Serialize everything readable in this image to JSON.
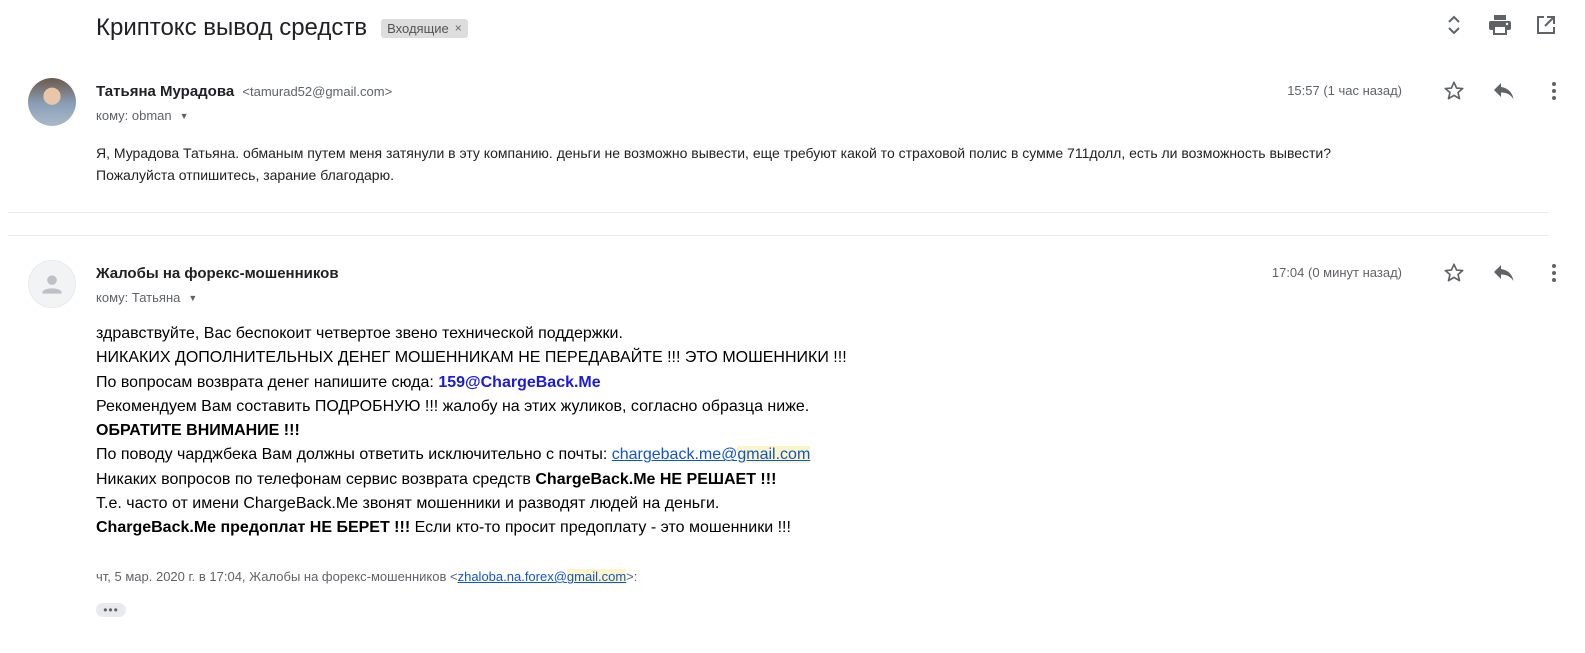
{
  "thread": {
    "subject": "Криптокс вывод средств",
    "label": "Входящие",
    "label_remove": "×"
  },
  "toolbar": {
    "icons": [
      "expand-collapse-icon",
      "print-icon",
      "open-new-window-icon"
    ]
  },
  "message1": {
    "sender_name": "Татьяна Мурадова",
    "sender_email": "<tamurad52@gmail.com>",
    "to_label": "кому: obman",
    "time": "15:57 (1 час назад)",
    "body_line1": "Я, Мурадова Татьяна. обманым путем меня затянули в эту компанию. деньги не возможно вывести,  еще  требуют какой то страховой полис в сумме 711долл,  есть ли возможность вывести?",
    "body_line2": "Пожалуйста отпишитесь, зарание благодарю."
  },
  "message2": {
    "sender_name": "Жалобы на форекс-мошенников",
    "to_label": "кому: Татьяна",
    "time": "17:04 (0 минут назад)",
    "line1": "здравствуйте, Вас беспокоит четвертое звено технической поддержки.",
    "line2": "НИКАКИХ ДОПОЛНИТЕЛЬНЫХ ДЕНЕГ МОШЕННИКАМ НЕ ПЕРЕДАВАЙТЕ !!! ЭТО МОШЕННИКИ !!!",
    "line3_prefix": "По вопросам возврата денег напишите сюда: ",
    "line3_email": "159@ChargeBack.Me",
    "line4": "Рекомендуем Вам составить ПОДРОБНУЮ !!! жалобу на этих жуликов, согласно образца ниже.",
    "line5": "ОБРАТИТЕ ВНИМАНИЕ !!!",
    "line6_prefix": "По поводу чарджбека Вам должны ответить исключительно с почты: ",
    "line6_link_a": "chargeback.me@",
    "line6_link_b": "gmail.com",
    "line7_prefix": "Никаких вопросов по телефонам сервис возврата средств ",
    "line7_bold": "ChargeBack.Me НЕ РЕШАЕТ !!!",
    "line8": "Т.е. часто от имени ChargeBack.Me звонят мошенники и разводят людей на деньги.",
    "line9_bold": "ChargeBack.Me предоплат НЕ БЕРЕТ !!!",
    "line9_rest": " Если кто-то просит предоплату - это мошенники !!!",
    "quote_prefix": "чт, 5 мар. 2020 г. в 17:04, Жалобы на форекс-мошенников <",
    "quote_link_a": "zhaloba.na.forex@",
    "quote_link_b": "gmail.com",
    "quote_suffix": ">:",
    "more_dots": "•••"
  }
}
